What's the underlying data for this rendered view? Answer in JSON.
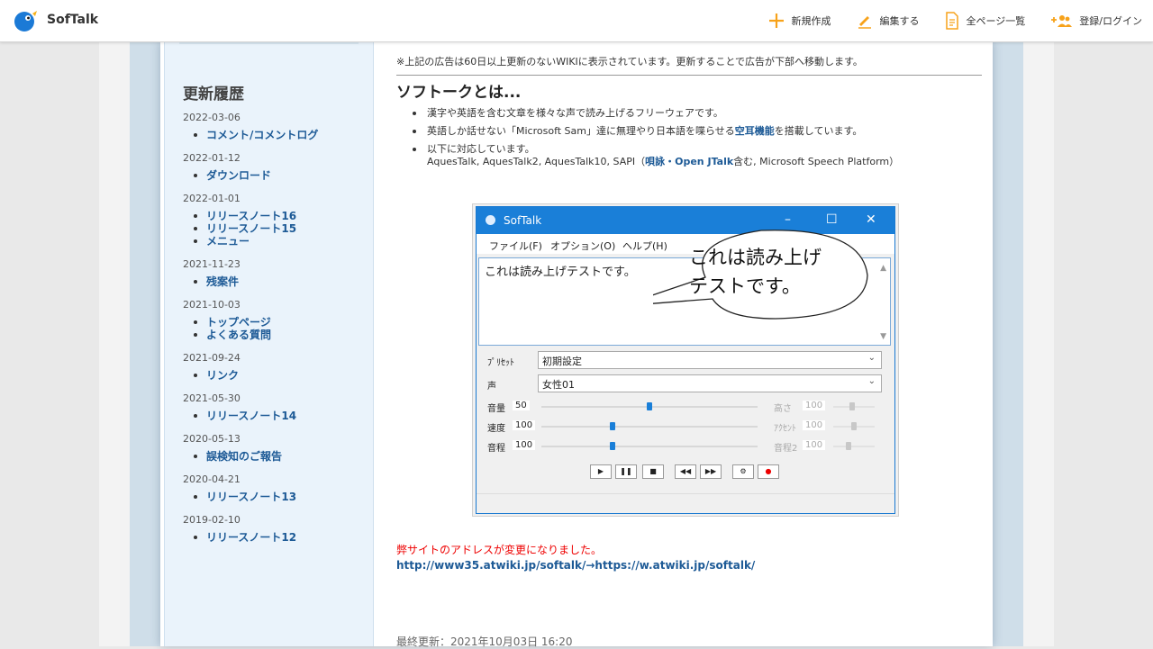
{
  "header": {
    "site_name": "SofTalk",
    "nav": {
      "new_page": "新規作成",
      "edit": "編集する",
      "all_pages": "全ページ一覧",
      "login": "登録/ログイン"
    }
  },
  "sidebar": {
    "title": "更新履歴",
    "groups": [
      {
        "date": "2022-03-06",
        "items": [
          "コメント/コメントログ"
        ]
      },
      {
        "date": "2022-01-12",
        "items": [
          "ダウンロード"
        ]
      },
      {
        "date": "2022-01-01",
        "items": [
          "リリースノート16",
          "リリースノート15",
          "メニュー"
        ]
      },
      {
        "date": "2021-11-23",
        "items": [
          "残案件"
        ]
      },
      {
        "date": "2021-10-03",
        "items": [
          "トップページ",
          "よくある質問"
        ]
      },
      {
        "date": "2021-09-24",
        "items": [
          "リンク"
        ]
      },
      {
        "date": "2021-05-30",
        "items": [
          "リリースノート14"
        ]
      },
      {
        "date": "2020-05-13",
        "items": [
          "誤検知のご報告"
        ]
      },
      {
        "date": "2020-04-21",
        "items": [
          "リリースノート13"
        ]
      },
      {
        "date": "2019-02-10",
        "items": [
          "リリースノート12"
        ]
      }
    ]
  },
  "content": {
    "ad_note": "※上記の広告は60日以上更新のないWIKIに表示されています。更新することで広告が下部へ移動します。",
    "heading": "ソフトークとは...",
    "bullet1": "漢字や英語を含む文章を様々な声で読み上げるフリーウェアです。",
    "bullet2_pre": "英語しか話せない「Microsoft Sam」達に無理やり日本語を喋らせる",
    "bullet2_link": "空耳機能",
    "bullet2_post": "を搭載しています。",
    "bullet3": "以下に対応しています。",
    "support_pre": "AquesTalk, AquesTalk2, AquesTalk10, SAPI（",
    "support_link": "唄詠・Open JTalk",
    "support_post": "含む, Microsoft Speech Platform）",
    "notice": "弊サイトのアドレスが変更になりました。",
    "address": "http://www35.atwiki.jp/softalk/→https://w.atwiki.jp/softalk/",
    "updated": "最終更新：2021年10月03日 16:20"
  },
  "app": {
    "title": "SofTalk",
    "menu": [
      "ファイル(F)",
      "オプション(O)",
      "ヘルプ(H)"
    ],
    "text": "これは読み上げテストです。",
    "bubble_line1": "これは読み上げ",
    "bubble_line2": "テストです。",
    "preset_label": "ﾌﾟﾘｾｯﾄ",
    "preset_value": "初期設定",
    "voice_label": "声",
    "voice_value": "女性01",
    "volume_label": "音量",
    "volume_value": "50",
    "speed_label": "速度",
    "speed_value": "100",
    "pitch_label": "音程",
    "pitch_value": "100",
    "height_label": "高さ",
    "height_value": "100",
    "accent_label": "ｱｸｾﾝﾄ",
    "accent_value": "100",
    "pitch2_label": "音程2",
    "pitch2_value": "100",
    "levels": {
      "volume": 0.5,
      "speed": 0.33,
      "pitch": 0.33
    }
  },
  "colors": {
    "link": "#1d5a96",
    "notice": "#e00000",
    "accent": "#1a7fd8",
    "nav_orange": "#f7a21a"
  }
}
